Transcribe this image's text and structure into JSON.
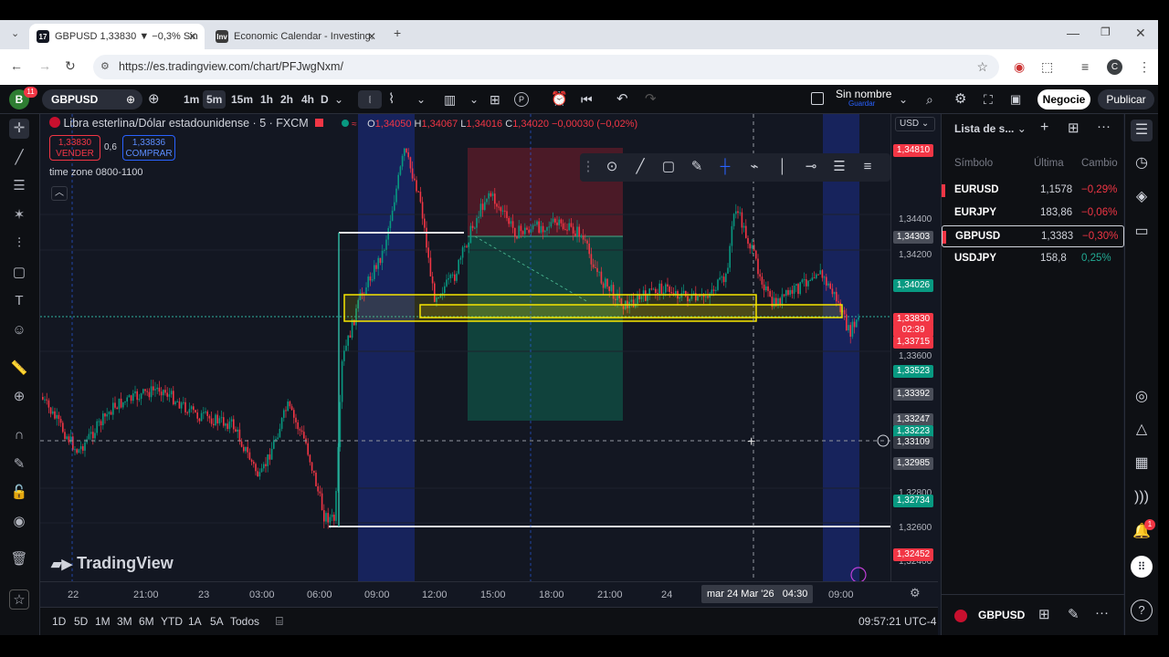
{
  "browser": {
    "tabs": [
      {
        "title": "GBPUSD 1,33830 ▼ −0,3% Sin",
        "favicon": "17"
      },
      {
        "title": "Economic Calendar - Investing.",
        "favicon": "Inv"
      }
    ],
    "url": "https://es.tradingview.com/chart/PFJwgNxm/",
    "profile_initial": "C"
  },
  "toolbar": {
    "notif_count": "11",
    "avatar_letter": "B",
    "symbol": "GBPUSD",
    "intervals": [
      "1m",
      "5m",
      "15m",
      "1h",
      "2h",
      "4h",
      "D"
    ],
    "active_interval": "5m",
    "layout_name": "Sin nombre",
    "layout_sub": "Guardar",
    "trade_button": "Negocie",
    "publish_button": "Publicar",
    "alt_label": "P"
  },
  "legend": {
    "title": "Libra esterlina/Dólar estadounidense · 5 · FXCM",
    "ohlc": {
      "o_label": "O",
      "o": "1,34050",
      "h_label": "H",
      "h": "1,34067",
      "l_label": "L",
      "l": "1,34016",
      "c_label": "C",
      "c": "1,34020",
      "change": "−0,00030 (−0,02%)"
    },
    "sell_price": "1,33830",
    "sell_label": "VENDER",
    "spread": "0,6",
    "buy_price": "1,33836",
    "buy_label": "COMPRAR",
    "indicator": "time zone 0800-1100"
  },
  "price_axis": {
    "currency": "USD",
    "labels": [
      "1,34400",
      "1,34200",
      "1,33600",
      "1,32800",
      "1,32600",
      "1,32400"
    ],
    "tags": [
      {
        "text": "1,34810",
        "color": "#f23645"
      },
      {
        "text": "1,34303",
        "color": "#4a4e59"
      },
      {
        "text": "1,34026",
        "color": "#089981"
      },
      {
        "text": "1,33830",
        "color": "#f23645"
      },
      {
        "text": "02:39",
        "color": "#f23645"
      },
      {
        "text": "1,33715",
        "color": "#f23645"
      },
      {
        "text": "1,33523",
        "color": "#089981"
      },
      {
        "text": "1,33392",
        "color": "#4a4e59"
      },
      {
        "text": "1,33247",
        "color": "#4a4e59"
      },
      {
        "text": "1,33223",
        "color": "#089981"
      },
      {
        "text": "1,33109",
        "color": "#363a45"
      },
      {
        "text": "1,32985",
        "color": "#4a4e59"
      },
      {
        "text": "1,32734",
        "color": "#089981"
      },
      {
        "text": "1,32452",
        "color": "#f23645"
      }
    ]
  },
  "time_axis": {
    "labels": [
      "22",
      "21:00",
      "23",
      "03:00",
      "06:00",
      "09:00",
      "12:00",
      "15:00",
      "18:00",
      "21:00",
      "24",
      "09:00"
    ],
    "crosshair_label": "mar 24 Mar '26   04:30"
  },
  "bottom": {
    "ranges": [
      "1D",
      "5D",
      "1M",
      "3M",
      "6M",
      "YTD",
      "1A",
      "5A",
      "Todos"
    ],
    "clock": "09:57:21 UTC-4"
  },
  "watermark": "TradingView",
  "watchlist": {
    "title": "Lista de s...",
    "col_symbol": "Símbolo",
    "col_last": "Última",
    "col_change": "Cambio",
    "rows": [
      {
        "symbol": "EURUSD",
        "last": "1,1578",
        "change": "−0,29%",
        "change_color": "#f23645",
        "flag": true
      },
      {
        "symbol": "EURJPY",
        "last": "183,86",
        "change": "−0,06%",
        "change_color": "#f23645",
        "flag": false
      },
      {
        "symbol": "GBPUSD",
        "last": "1,3383",
        "change": "−0,30%",
        "change_color": "#f23645",
        "flag": true
      },
      {
        "symbol": "USDJPY",
        "last": "158,8",
        "change": "0,25%",
        "change_color": "#22ab94",
        "flag": false
      }
    ],
    "footer_symbol": "GBPUSD"
  },
  "right_notif_count": "1",
  "colors": {
    "up": "#089981",
    "down": "#f23645",
    "zone": "#1c2e8c",
    "box": "#f7e600",
    "bg": "#131722"
  }
}
